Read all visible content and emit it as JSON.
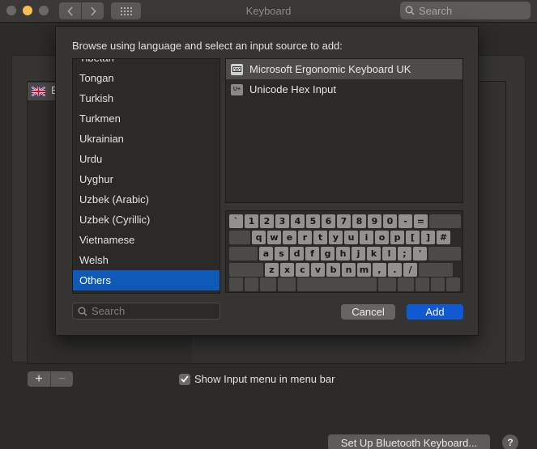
{
  "window": {
    "title": "Keyboard",
    "search_placeholder": "Search"
  },
  "background": {
    "selected_input_letter": "E",
    "show_input_menu_label": "Show Input menu in menu bar",
    "show_input_menu_checked": true,
    "bluetooth_button": "Set Up Bluetooth Keyboard...",
    "help_label": "?",
    "plus_label": "+",
    "minus_label": "−"
  },
  "sheet": {
    "prompt": "Browse using language and select an input source to add:",
    "languages": [
      "Tibetan",
      "Tongan",
      "Turkish",
      "Turkmen",
      "Ukrainian",
      "Urdu",
      "Uyghur",
      "Uzbek (Arabic)",
      "Uzbek (Cyrillic)",
      "Vietnamese",
      "Welsh",
      "Others"
    ],
    "selected_language": "Others",
    "sources": [
      {
        "label": "Microsoft Ergonomic Keyboard UK",
        "icon": "keyboard-icon"
      },
      {
        "label": "Unicode Hex Input",
        "icon": "unicode-hex-icon",
        "icon_text": "U+"
      }
    ],
    "keyboard_rows": [
      [
        "`",
        "1",
        "2",
        "3",
        "4",
        "5",
        "6",
        "7",
        "8",
        "9",
        "0",
        "-",
        "="
      ],
      [
        "q",
        "w",
        "e",
        "r",
        "t",
        "y",
        "u",
        "i",
        "o",
        "p",
        "[",
        "]",
        "#"
      ],
      [
        "a",
        "s",
        "d",
        "f",
        "g",
        "h",
        "j",
        "k",
        "l",
        ";",
        "'"
      ],
      [
        "z",
        "x",
        "c",
        "v",
        "b",
        "n",
        "m",
        ",",
        ".",
        "/"
      ]
    ],
    "search_placeholder": "Search",
    "cancel_label": "Cancel",
    "add_label": "Add"
  },
  "colors": {
    "accent": "#0f5ad2",
    "selection": "#0f5ab8",
    "minimize": "#f6be4f"
  }
}
